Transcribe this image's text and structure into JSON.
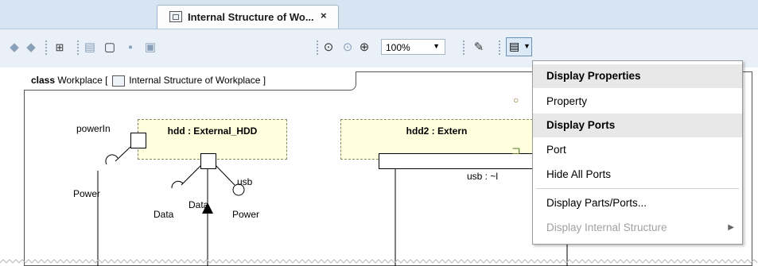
{
  "tab": {
    "title": "Internal Structure of Wo...",
    "close": "×"
  },
  "toolbar": {
    "icons": [
      "back-arrow-icon",
      "forward-arrow-icon",
      "tree-icon",
      "copy-icon",
      "paste-icon",
      "delete-icon",
      "delete-model-icon",
      "zoom-fit-icon",
      "zoom-selection-icon",
      "zoom-in-icon",
      "zoom-out-icon",
      "pen-icon",
      "display-icon"
    ],
    "zoom_value": "100%"
  },
  "diagram": {
    "frame_keyword": "class",
    "frame_name": "Workplace [",
    "frame_inner": "Internal Structure of Workplace ]",
    "part1_title": "hdd : External_HDD",
    "part2_title": "hdd2 : Extern",
    "labels": {
      "powerIn": "powerIn",
      "usb": "usb",
      "power1": "Power",
      "data1": "Data",
      "data2": "Data",
      "power2": "Power",
      "usb2": "usb : ~l"
    }
  },
  "menu": {
    "items": [
      {
        "label": "Display Properties",
        "type": "header"
      },
      {
        "label": "Property",
        "icon": "○"
      },
      {
        "label": "Display Ports",
        "type": "header"
      },
      {
        "label": "Port",
        "icon": "⊐"
      },
      {
        "label": "Hide All Ports"
      },
      {
        "label": "Display Parts/Ports..."
      },
      {
        "label": "Display Internal Structure",
        "disabled": true
      }
    ]
  }
}
